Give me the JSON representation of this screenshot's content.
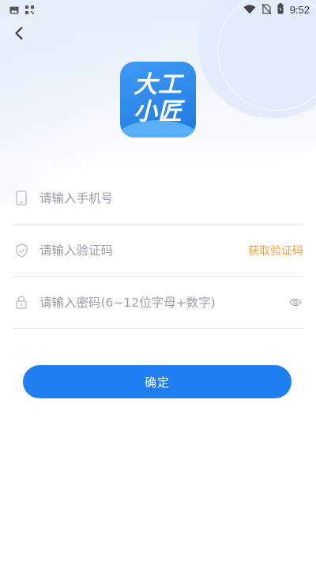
{
  "status_bar": {
    "time": "9:52",
    "icons": [
      "image-icon",
      "qr-icon",
      "wifi-icon",
      "no-sim-icon",
      "battery-charging-icon"
    ]
  },
  "header": {
    "back_icon": "chevron-left-icon"
  },
  "logo": {
    "line1": "大工",
    "line2": "小匠",
    "colors": {
      "bg_top": "#3f9bf5",
      "bg_bottom": "#1f78e0"
    }
  },
  "form": {
    "phone": {
      "placeholder": "请输入手机号",
      "value": "",
      "icon": "phone-icon"
    },
    "code": {
      "placeholder": "请输入验证码",
      "value": "",
      "icon": "shield-icon",
      "get_code_label": "获取验证码"
    },
    "password": {
      "placeholder": "请输入密码(6~12位字母+数字)",
      "value": "",
      "icon": "lock-icon",
      "toggle_icon": "eye-icon"
    }
  },
  "confirm_label": "确定",
  "colors": {
    "accent": "#1f7ef0",
    "link_orange": "#f0a23a",
    "placeholder": "#9aa0a6"
  }
}
